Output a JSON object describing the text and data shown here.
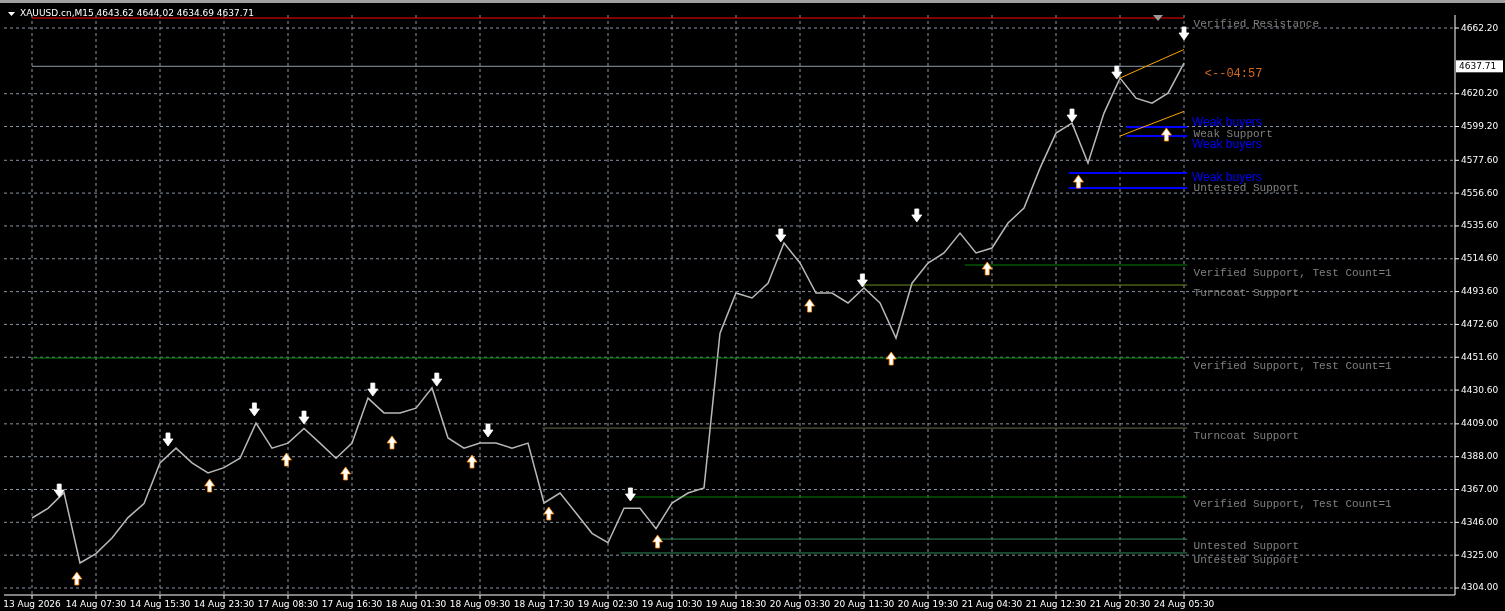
{
  "chart": {
    "title": "XAUUSD.cn,M15 4643.62 4644.02 4634.69 4637.71",
    "timer": "<--04:57",
    "current_price": "4637.71",
    "zone_labels": [
      {
        "text": "Verified Resistance",
        "color": "#808080"
      },
      {
        "text": "Weak buyers",
        "color": "#0000ff"
      },
      {
        "text": "Weak Support",
        "color": "#808080"
      },
      {
        "text": "Weak buyers",
        "color": "#0000ff"
      },
      {
        "text": "Weak buyers",
        "color": "#0000ff"
      },
      {
        "text": "Untested Support",
        "color": "#808080"
      },
      {
        "text": "Verified Support, Test Count=1",
        "color": "#808080"
      },
      {
        "text": "Turncoat Support",
        "color": "#808080"
      },
      {
        "text": "Verified Support, Test Count=1",
        "color": "#808080"
      },
      {
        "text": "Turncoat Support",
        "color": "#808080"
      },
      {
        "text": "Verified Support, Test Count=1",
        "color": "#808080"
      },
      {
        "text": "Untested Support",
        "color": "#808080"
      },
      {
        "text": "Untested Support",
        "color": "#808080"
      }
    ],
    "chart_data": {
      "type": "line",
      "grid": true,
      "ylim": [
        4299.52,
        4670.54
      ],
      "categories": [
        "13 Aug 2026",
        null,
        null,
        null,
        "14 Aug 07:30",
        null,
        null,
        null,
        "14 Aug 15:30",
        null,
        null,
        null,
        "14 Aug 23:30",
        null,
        null,
        null,
        "17 Aug 08:30",
        null,
        null,
        null,
        "17 Aug 16:30",
        null,
        null,
        null,
        "18 Aug 01:30",
        null,
        null,
        null,
        "18 Aug 09:30",
        null,
        null,
        null,
        "18 Aug 17:30",
        null,
        null,
        null,
        "19 Aug 02:30",
        null,
        null,
        null,
        "19 Aug 10:30",
        null,
        null,
        null,
        "19 Aug 18:30",
        null,
        null,
        null,
        "20 Aug 03:30",
        null,
        null,
        null,
        "20 Aug 11:30",
        null,
        null,
        null,
        "20 Aug 19:30",
        null,
        null,
        null,
        "21 Aug 04:30",
        null,
        null,
        null,
        "21 Aug 12:30",
        null,
        null,
        null,
        "21 Aug 20:30",
        null,
        null,
        null,
        "24 Aug 05:30"
      ],
      "series": [
        {
          "color": "#b8b8b8",
          "values": [
            4348.8,
            4355,
            4365,
            4320,
            4326,
            4336,
            4349,
            4358,
            4384,
            4393.5,
            4384,
            4377.6,
            4381,
            4387,
            4409.5,
            4393.5,
            4396.7,
            4406,
            4396.7,
            4387,
            4396.7,
            4425.5,
            4416,
            4416,
            4419,
            4432,
            4400,
            4393.5,
            4396.7,
            4396.7,
            4393.5,
            4396.7,
            4358.4,
            4364.8,
            4352,
            4339,
            4333,
            4355,
            4355,
            4342,
            4358.4,
            4364.8,
            4368,
            4467,
            4492.7,
            4489.5,
            4499,
            4524.7,
            4511.9,
            4492.7,
            4492.7,
            4486.3,
            4495.9,
            4486.3,
            4463.9,
            4499,
            4511.9,
            4518.3,
            4531,
            4518.3,
            4521.5,
            4537.5,
            4547,
            4572.6,
            4595,
            4601.4,
            4575.8,
            4607.8,
            4630.2,
            4617.4,
            4614.2,
            4620.6,
            4639.8
          ]
        },
        {
          "color": "#ff0000",
          "values": [
            4668.6,
            4668.6,
            4668.6,
            4668.6,
            4668.6,
            4668.6,
            4668.6,
            4668.6,
            4668.6,
            4668.6,
            4668.6,
            4668.6,
            4668.6,
            4668.6,
            4668.6,
            4668.6,
            4668.6,
            4668.6,
            4668.6,
            4668.6,
            4668.6,
            4668.6,
            4668.6,
            4668.6,
            4668.6,
            4668.6,
            4668.6,
            4668.6,
            4668.6,
            4668.6,
            4668.6,
            4668.6,
            4668.6,
            4668.6,
            4668.6,
            4668.6,
            4668.6,
            4668.6,
            4668.6,
            4668.6,
            4668.6,
            4668.6,
            4668.6,
            4668.6,
            4668.6,
            4668.6,
            4668.6,
            4668.6,
            4668.6,
            4668.6,
            4668.6,
            4668.6,
            4668.6,
            4668.6,
            4668.6,
            4668.6,
            4668.6,
            4668.6,
            4668.6,
            4668.6,
            4668.6,
            4668.6,
            4668.6,
            4668.6,
            4668.6,
            4668.6,
            4668.6,
            4668.6,
            4668.6,
            4668.6,
            4668.6,
            4668.6,
            4668.6
          ]
        },
        {
          "color": "#8c9aa8",
          "values": [
            4637.71,
            4637.71,
            4637.71,
            4637.71,
            4637.71,
            4637.71,
            4637.71,
            4637.71,
            4637.71,
            4637.71,
            4637.71,
            4637.71,
            4637.71,
            4637.71,
            4637.71,
            4637.71,
            4637.71,
            4637.71,
            4637.71,
            4637.71,
            4637.71,
            4637.71,
            4637.71,
            4637.71,
            4637.71,
            4637.71,
            4637.71,
            4637.71,
            4637.71,
            4637.71,
            4637.71,
            4637.71,
            4637.71,
            4637.71,
            4637.71,
            4637.71,
            4637.71,
            4637.71,
            4637.71,
            4637.71,
            4637.71,
            4637.71,
            4637.71,
            4637.71,
            4637.71,
            4637.71,
            4637.71,
            4637.71,
            4637.71,
            4637.71,
            4637.71,
            4637.71,
            4637.71,
            4637.71,
            4637.71,
            4637.71,
            4637.71,
            4637.71,
            4637.71,
            4637.71,
            4637.71,
            4637.71,
            4637.71,
            4637.71,
            4637.71,
            4637.71,
            4637.71,
            4637.71,
            4637.71,
            4637.71,
            4637.71,
            4637.71,
            4637.71
          ]
        },
        {
          "color": "#008000",
          "values": [
            4451.1,
            4451.1,
            4451.1,
            4451.1,
            4451.1,
            4451.1,
            4451.1,
            4451.1,
            4451.1,
            4451.1,
            4451.1,
            4451.1,
            4451.1,
            4451.1,
            4451.1,
            4451.1,
            4451.1,
            4451.1,
            4451.1,
            4451.1,
            4451.1,
            4451.1,
            4451.1,
            4451.1,
            4451.1,
            4451.1,
            4451.1,
            4451.1,
            4451.1,
            4451.1,
            4451.1,
            4451.1,
            4451.1,
            4451.1,
            4451.1,
            4451.1,
            4451.1,
            4451.1,
            4451.1,
            4451.1,
            4451.1,
            4451.1,
            4451.1,
            4451.1,
            4451.1,
            4451.1,
            4451.1,
            4451.1,
            4451.1,
            4451.1,
            4451.1,
            4451.1,
            4451.1,
            4451.1,
            4451.1,
            4451.1,
            4451.1,
            4451.1,
            4451.1,
            4451.1,
            4451.1,
            4451.1,
            4451.1,
            4451.1,
            4451.1,
            4451.1,
            4451.1,
            4451.1,
            4451.1,
            4451.1,
            4451.1,
            4451.1,
            4451.1
          ]
        },
        {
          "color": "#ffa500",
          "values": [
            null,
            null,
            null,
            null,
            null,
            null,
            null,
            null,
            null,
            null,
            null,
            null,
            null,
            null,
            null,
            null,
            null,
            null,
            null,
            null,
            null,
            null,
            null,
            null,
            null,
            null,
            null,
            null,
            null,
            null,
            null,
            null,
            null,
            null,
            null,
            null,
            null,
            null,
            null,
            null,
            null,
            null,
            null,
            null,
            null,
            null,
            null,
            null,
            null,
            null,
            null,
            null,
            null,
            null,
            null,
            null,
            null,
            null,
            null,
            null,
            null,
            null,
            null,
            null,
            null,
            null,
            null,
            null,
            4630.2,
            4634.8,
            4639.4,
            4643.9,
            4648.5
          ]
        },
        {
          "color": "#ffa500",
          "values": [
            null,
            null,
            null,
            null,
            null,
            null,
            null,
            null,
            null,
            null,
            null,
            null,
            null,
            null,
            null,
            null,
            null,
            null,
            null,
            null,
            null,
            null,
            null,
            null,
            null,
            null,
            null,
            null,
            null,
            null,
            null,
            null,
            null,
            null,
            null,
            null,
            null,
            null,
            null,
            null,
            null,
            null,
            null,
            null,
            null,
            null,
            null,
            null,
            null,
            null,
            null,
            null,
            null,
            null,
            null,
            null,
            null,
            null,
            null,
            null,
            null,
            null,
            null,
            null,
            null,
            null,
            null,
            null,
            4593.1,
            4597.1,
            4601.0,
            4605.0,
            4608.9
          ]
        }
      ],
      "yticks": [
        {
          "value": 4662.2,
          "label": "4662.20"
        },
        {
          "value": 4620.2,
          "label": "4620.20"
        },
        {
          "value": 4599.2,
          "label": "4599.20"
        },
        {
          "value": 4577.6,
          "label": "4577.60"
        },
        {
          "value": 4556.6,
          "label": "4556.60"
        },
        {
          "value": 4535.6,
          "label": "4535.60"
        },
        {
          "value": 4514.6,
          "label": "4514.60"
        },
        {
          "value": 4493.6,
          "label": "4493.60"
        },
        {
          "value": 4472.6,
          "label": "4472.60"
        },
        {
          "value": 4451.6,
          "label": "4451.60"
        },
        {
          "value": 4430.6,
          "label": "4430.60"
        },
        {
          "value": 4409,
          "label": "4409.00"
        },
        {
          "value": 4388,
          "label": "4388.00"
        },
        {
          "value": 4367,
          "label": "4367.00"
        },
        {
          "value": 4346,
          "label": "4346.00"
        },
        {
          "value": 4325,
          "label": "4325.00"
        },
        {
          "value": 4304,
          "label": "4304.00"
        }
      ]
    }
  }
}
